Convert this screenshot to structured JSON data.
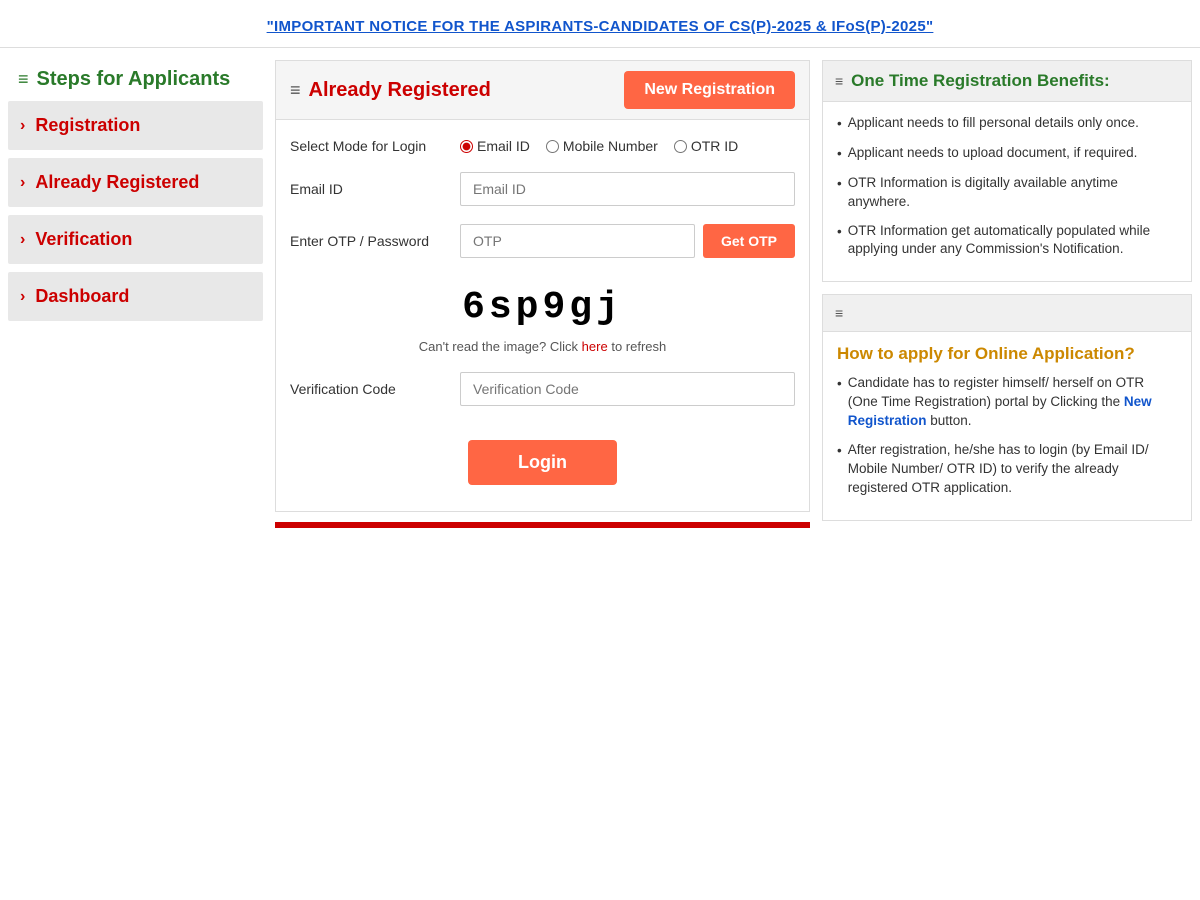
{
  "notice": {
    "text": "\"IMPORTANT NOTICE FOR THE ASPIRANTS-CANDIDATES OF CS(P)-2025 & IFoS(P)-2025\"",
    "href": "#"
  },
  "left_panel": {
    "title": "Steps for Applicants",
    "hamburger": "≡",
    "steps": [
      {
        "label": "Registration"
      },
      {
        "label": "Already Registered"
      },
      {
        "label": "Verification"
      },
      {
        "label": "Dashboard"
      }
    ]
  },
  "center": {
    "hamburger": "≡",
    "already_registered_label": "Already Registered",
    "new_registration_label": "New Registration",
    "select_mode_label": "Select Mode for Login",
    "login_modes": [
      {
        "label": "Email ID",
        "value": "email",
        "checked": true
      },
      {
        "label": "Mobile Number",
        "value": "mobile",
        "checked": false
      },
      {
        "label": "OTR ID",
        "value": "otr",
        "checked": false
      }
    ],
    "email_label": "Email ID",
    "email_placeholder": "Email ID",
    "otp_label": "Enter OTP / Password",
    "otp_placeholder": "OTP",
    "get_otp_label": "Get OTP",
    "captcha_text": "6sp9gj",
    "captcha_refresh_text": "Can't read the image? Click",
    "captcha_refresh_link": "here",
    "captcha_refresh_suffix": "to refresh",
    "verification_label": "Verification Code",
    "verification_placeholder": "Verification Code",
    "login_label": "Login"
  },
  "right_panel": {
    "otr_benefits": {
      "hamburger": "≡",
      "title": "One Time Registration Benefits:",
      "items": [
        "Applicant needs to fill personal details only once.",
        "Applicant needs to upload document, if required.",
        "OTR Information is digitally available anytime anywhere.",
        "OTR Information get automatically populated while applying under any Commission's Notification."
      ]
    },
    "how_to": {
      "hamburger": "≡",
      "title": "How to apply for Online Application?",
      "items": [
        {
          "text_before": "Candidate has to register himself/ herself on OTR (One Time Registration) portal by Clicking the ",
          "link_text": "New Registration",
          "text_after": " button."
        },
        {
          "text_before": "After registration, he/she has to login (by Email ID/ Mobile Number/ OTR ID) to verify the already registered OTR application.",
          "link_text": "",
          "text_after": ""
        }
      ]
    }
  }
}
